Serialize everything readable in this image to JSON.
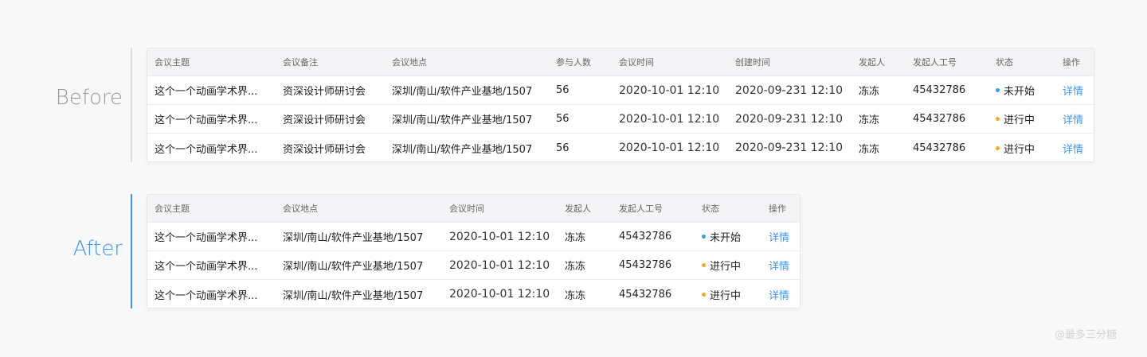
{
  "labels": {
    "before": "Before",
    "after": "After"
  },
  "watermark": "@最多三分糖",
  "colors": {
    "link": "#3d97f0",
    "status_not_started": "#3d97f0",
    "status_in_progress": "#f5a623"
  },
  "before": {
    "headers": [
      "会议主题",
      "会议备注",
      "会议地点",
      "参与人数",
      "会议时间",
      "创建时间",
      "发起人",
      "发起人工号",
      "状态",
      "操作"
    ],
    "rows": [
      {
        "topic": "这个一个动画学术界...",
        "note": "资深设计师研讨会",
        "location": "深圳/南山/软件产业基地/1507",
        "count": "56",
        "time": "2020-10-01 12:10",
        "created": "2020-09-231 12:10",
        "host": "冻冻",
        "host_id": "45432786",
        "status": "未开始",
        "action": "详情"
      },
      {
        "topic": "这个一个动画学术界...",
        "note": "资深设计师研讨会",
        "location": "深圳/南山/软件产业基地/1507",
        "count": "56",
        "time": "2020-10-01 12:10",
        "created": "2020-09-231 12:10",
        "host": "冻冻",
        "host_id": "45432786",
        "status": "进行中",
        "action": "详情"
      },
      {
        "topic": "这个一个动画学术界...",
        "note": "资深设计师研讨会",
        "location": "深圳/南山/软件产业基地/1507",
        "count": "56",
        "time": "2020-10-01 12:10",
        "created": "2020-09-231 12:10",
        "host": "冻冻",
        "host_id": "45432786",
        "status": "进行中",
        "action": "详情"
      }
    ]
  },
  "after": {
    "headers": [
      "会议主题",
      "会议地点",
      "会议时间",
      "发起人",
      "发起人工号",
      "状态",
      "操作"
    ],
    "rows": [
      {
        "topic": "这个一个动画学术界...",
        "location": "深圳/南山/软件产业基地/1507",
        "time": "2020-10-01 12:10",
        "host": "冻冻",
        "host_id": "45432786",
        "status": "未开始",
        "action": "详情"
      },
      {
        "topic": "这个一个动画学术界...",
        "location": "深圳/南山/软件产业基地/1507",
        "time": "2020-10-01 12:10",
        "host": "冻冻",
        "host_id": "45432786",
        "status": "进行中",
        "action": "详情"
      },
      {
        "topic": "这个一个动画学术界...",
        "location": "深圳/南山/软件产业基地/1507",
        "time": "2020-10-01 12:10",
        "host": "冻冻",
        "host_id": "45432786",
        "status": "进行中",
        "action": "详情"
      }
    ]
  }
}
